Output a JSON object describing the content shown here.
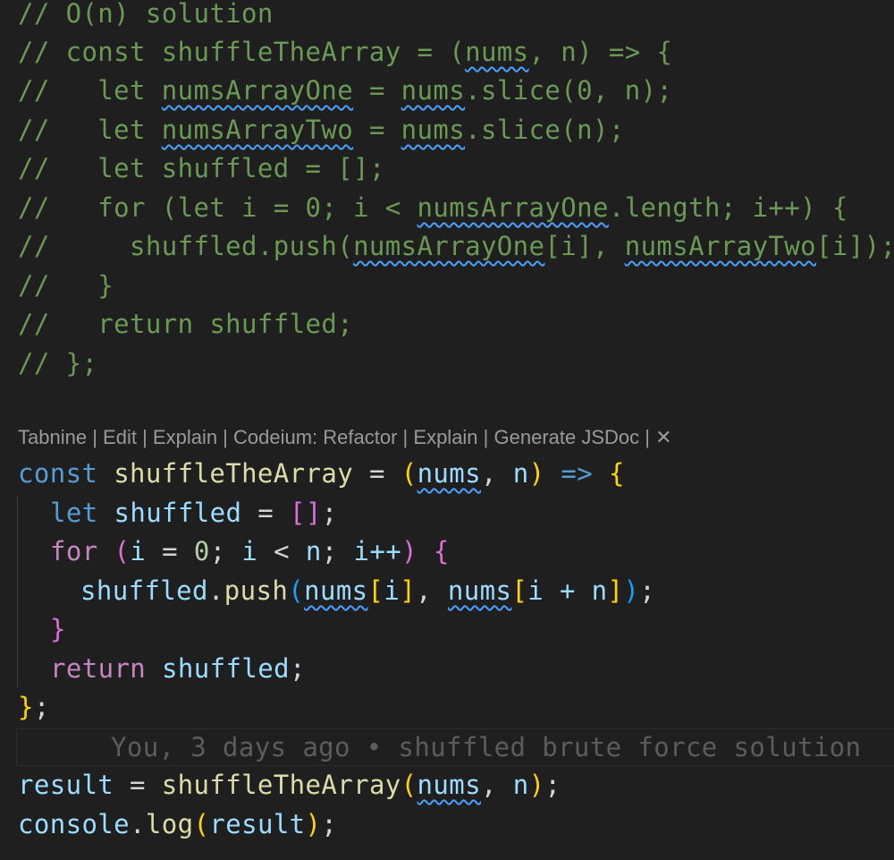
{
  "comment_block": {
    "header": "// O(n) solution",
    "signature_prefix": "// const shuffleTheArray = (",
    "signature_nums": "nums",
    "signature_suffix": ", n) => {",
    "l3_prefix": "//   let ",
    "l3_var": "numsArrayOne",
    "l3_mid": " = ",
    "l3_nums": "nums",
    "l3_suffix": ".slice(0, n);",
    "l4_prefix": "//   let ",
    "l4_var": "numsArrayTwo",
    "l4_mid": " = ",
    "l4_nums": "nums",
    "l4_suffix": ".slice(n);",
    "l5": "//   let shuffled = [];",
    "l6_prefix": "//   for (let i = 0; i < ",
    "l6_var": "numsArrayOne",
    "l6_suffix": ".length; i++) {",
    "l7_prefix": "//     shuffled.push(",
    "l7_var1": "numsArrayOne",
    "l7_mid": "[i], ",
    "l7_var2": "numsArrayTwo",
    "l7_suffix": "[i]);",
    "l8": "//   }",
    "l9": "//   return shuffled;",
    "l10": "// };"
  },
  "codelens": {
    "tabnine": "Tabnine",
    "edit": "Edit",
    "explain1": "Explain",
    "codeium_refactor": "Codeium: Refactor",
    "explain2": "Explain",
    "generate_jsdoc": "Generate JSDoc",
    "sep": " | ",
    "close": "✕"
  },
  "code": {
    "kw_const": "const",
    "fn_name": "shuffleTheArray",
    "eq": " = ",
    "paren_open": "(",
    "param_nums": "nums",
    "comma": ", ",
    "param_n": "n",
    "paren_close": ")",
    "arrow": " => ",
    "brace_open": "{",
    "kw_let": "let",
    "var_shuffled": "shuffled",
    "empty_array": "[]",
    "semicolon": ";",
    "kw_for": "for",
    "loop_paren_open": "(",
    "loop_i": "i",
    "loop_init": " = ",
    "loop_zero": "0",
    "loop_semi": "; ",
    "loop_i2": "i",
    "loop_lt": " < ",
    "loop_n": "n",
    "loop_semi2": "; ",
    "loop_inc": "i++",
    "loop_paren_close": ")",
    "loop_brace_open": "{",
    "push_obj": "shuffled",
    "push_dot": ".",
    "push_fn": "push",
    "push_paren_open": "(",
    "push_arg1": "nums",
    "bracket1_open": "[",
    "idx1": "i",
    "bracket1_close": "]",
    "push_comma": ", ",
    "push_arg2": "nums",
    "bracket2_open": "[",
    "idx2": "i + n",
    "bracket2_close": "]",
    "push_paren_close": ")",
    "loop_brace_close": "}",
    "kw_return": "return",
    "ret_shuffled": "shuffled",
    "fn_end_brace": "}",
    "result_var": "result",
    "call_fn": "shuffleTheArray",
    "call_arg_nums": "nums",
    "call_comma": ", ",
    "call_arg_n": "n",
    "console": "console",
    "log_fn": "log",
    "log_arg": "result"
  },
  "blame": {
    "text": "You, 3 days ago • shuffled brute force solution"
  },
  "colors": {
    "background": "#1f1f1f",
    "comment": "#6a9955",
    "keyword": "#569cd6",
    "function": "#dcdcaa",
    "variable": "#9cdcfe",
    "control": "#c586c0",
    "squiggle": "#4aa1ff"
  }
}
